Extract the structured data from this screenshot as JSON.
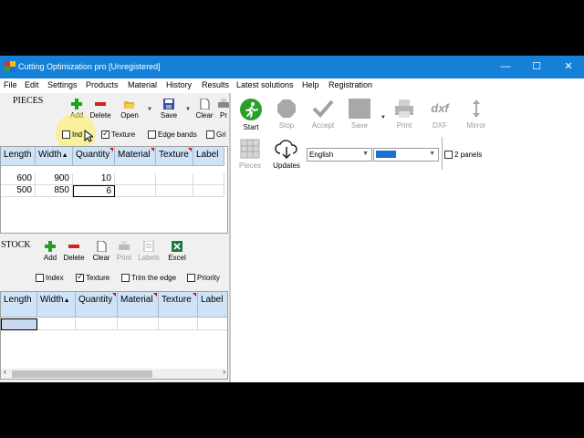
{
  "window": {
    "title": "Cutting Optimization pro [Unregistered]",
    "controls": {
      "minimize": "—",
      "maximize": "☐",
      "close": "✕"
    }
  },
  "menu": [
    "File",
    "Edit",
    "Settings",
    "Products",
    "Material",
    "History",
    "Results",
    "Latest solutions",
    "Help",
    "Registration"
  ],
  "pieces": {
    "label": "PIECES",
    "toolbar": {
      "add": "Add",
      "delete": "Delete",
      "open": "Open",
      "save": "Save",
      "clear": "Clear",
      "print": "Pr"
    },
    "options": [
      {
        "label": "Ind",
        "checked": false
      },
      {
        "label": "Texture",
        "checked": true
      },
      {
        "label": "Edge bands",
        "checked": false
      },
      {
        "label": "Gri",
        "checked": false
      }
    ],
    "columns": [
      "Length",
      "Width",
      "Quantity",
      "Material",
      "Texture",
      "Label"
    ],
    "sort_arrow": "▲",
    "rows": [
      [
        "600",
        "900",
        "10",
        "",
        "",
        ""
      ],
      [
        "500",
        "850",
        "6",
        "",
        "",
        ""
      ]
    ]
  },
  "stock": {
    "label": "STOCK",
    "toolbar": {
      "add": "Add",
      "delete": "Delete",
      "clear": "Clear",
      "print": "Print",
      "labels": "Labels",
      "excel": "Excel"
    },
    "options": [
      {
        "label": "Index",
        "checked": false
      },
      {
        "label": "Texture",
        "checked": true
      },
      {
        "label": "Trim the edge",
        "checked": false
      },
      {
        "label": "Priority",
        "checked": false
      }
    ],
    "columns": [
      "Length",
      "Width",
      "Quantity",
      "Material",
      "Texture",
      "Label"
    ],
    "sort_arrow": "▲"
  },
  "results_toolbar": {
    "start": "Start",
    "stop": "Stop",
    "accept": "Accept",
    "save": "Save",
    "print": "Print",
    "dxf": "DXF",
    "dxf_glyph": "dxf",
    "mirror": "Mirror",
    "pieces": "Pieces",
    "updates": "Updates",
    "language": "English",
    "two_panels": "2 panels",
    "two_panels_checked": false
  },
  "colors": {
    "titlebar": "#1480d8",
    "grid_header": "#cfe3f7",
    "start_green": "#2aa02a",
    "color_swatch": "#1a6fd0"
  }
}
